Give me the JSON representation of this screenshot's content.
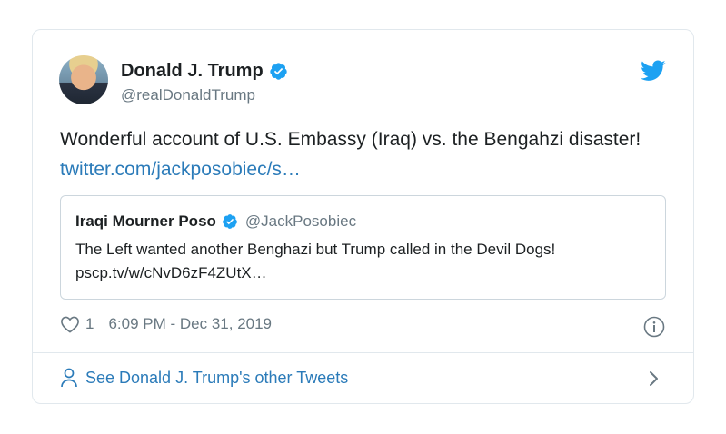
{
  "tweet": {
    "author_name": "Donald J. Trump",
    "author_handle": "@realDonaldTrump",
    "text_main": "Wonderful account of U.S. Embassy (Iraq) vs. the Bengahzi disaster! ",
    "text_link": "twitter.com/jackposobiec/s…",
    "likes": "1",
    "timestamp": "6:09 PM - Dec 31, 2019"
  },
  "quoted": {
    "author_name": "Iraqi Mourner Poso",
    "author_handle": "@JackPosobiec",
    "text": "The Left wanted another Benghazi but Trump called in the Devil Dogs! pscp.tv/w/cNvD6zF4ZUtX…"
  },
  "footer": {
    "label": "See Donald J. Trump's other Tweets"
  },
  "icons": {
    "verified": "verified-badge-icon",
    "twitter": "twitter-bird-icon",
    "heart": "heart-icon",
    "info": "info-icon",
    "person": "person-icon",
    "chevron": "chevron-right-icon"
  },
  "colors": {
    "accent": "#1da1f2",
    "link": "#2b7bb9",
    "muted": "#697882",
    "border": "#e1e8ed"
  }
}
